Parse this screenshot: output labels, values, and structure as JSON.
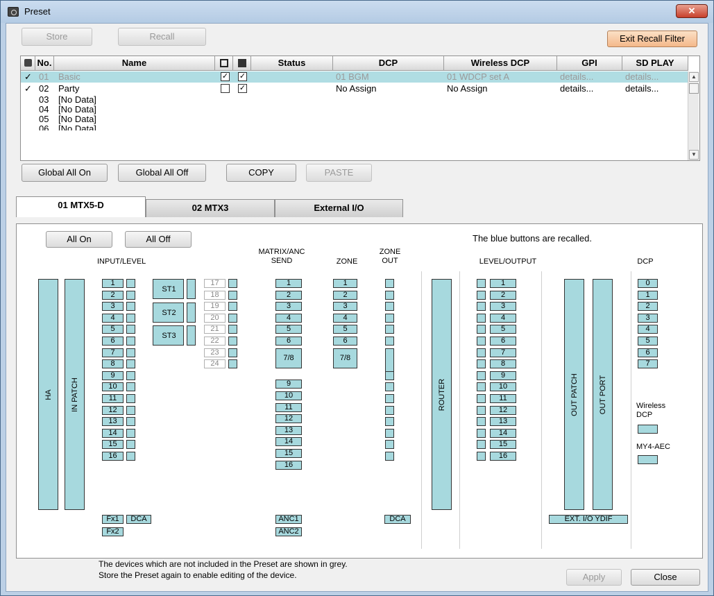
{
  "window": {
    "title": "Preset",
    "close": "✕"
  },
  "toolbar": {
    "store": "Store",
    "recall": "Recall",
    "exit_recall_filter": "Exit Recall Filter"
  },
  "table": {
    "columns": {
      "no": "No.",
      "name": "Name",
      "status": "Status",
      "dcp": "DCP",
      "wireless_dcp": "Wireless DCP",
      "gpi": "GPI",
      "sd_play": "SD PLAY"
    },
    "rows": [
      {
        "check": "✓",
        "no": "01",
        "name": "Basic",
        "lock": "✓",
        "recall": "✓",
        "dcp": "01 BGM",
        "wireless_dcp": "01 WDCP set A",
        "gpi": "details...",
        "sd_play": "details..."
      },
      {
        "check": "✓",
        "no": "02",
        "name": "Party",
        "lock": "",
        "recall": "✓",
        "dcp": "No Assign",
        "wireless_dcp": "No Assign",
        "gpi": "details...",
        "sd_play": "details..."
      },
      {
        "no": "03",
        "name": "[No Data]"
      },
      {
        "no": "04",
        "name": "[No Data]"
      },
      {
        "no": "05",
        "name": "[No Data]"
      },
      {
        "no": "06",
        "name": "[No Data]"
      }
    ]
  },
  "actions": {
    "global_all_on": "Global All On",
    "global_all_off": "Global All Off",
    "copy": "COPY",
    "paste": "PASTE"
  },
  "tabs": [
    "01 MTX5-D",
    "02 MTX3",
    "External I/O"
  ],
  "panel": {
    "all_on": "All On",
    "all_off": "All Off",
    "info": "The blue buttons are recalled.",
    "ha": "HA",
    "in_patch": "IN PATCH",
    "input_level": "INPUT/LEVEL",
    "matrix_send": "MATRIX/ANC\nSEND",
    "zone": "ZONE",
    "zone_out": "ZONE\nOUT",
    "router": "ROUTER",
    "level_output": "LEVEL/OUTPUT",
    "out_patch": "OUT PATCH",
    "out_port": "OUT PORT",
    "dcp": "DCP",
    "st": [
      "ST1",
      "ST2",
      "ST3"
    ],
    "inputs": [
      "1",
      "2",
      "3",
      "4",
      "5",
      "6",
      "7",
      "8",
      "9",
      "10",
      "11",
      "12",
      "13",
      "14",
      "15",
      "16"
    ],
    "inputs_b": [
      "17",
      "18",
      "19",
      "20",
      "21",
      "22",
      "23",
      "24"
    ],
    "zones": [
      "1",
      "2",
      "3",
      "4",
      "5",
      "6",
      "7/8"
    ],
    "matrix": [
      "1",
      "2",
      "3",
      "4",
      "5",
      "6",
      "7/8",
      "9",
      "10",
      "11",
      "12",
      "13",
      "14",
      "15",
      "16"
    ],
    "dcp_items": [
      "0",
      "1",
      "2",
      "3",
      "4",
      "5",
      "6",
      "7"
    ],
    "fx1": "Fx1",
    "fx2": "Fx2",
    "dca": "DCA",
    "anc1": "ANC1",
    "anc2": "ANC2",
    "zone_dca": "DCA",
    "ext_io": "EXT. I/O YDIF",
    "wireless_dcp": "Wireless\nDCP",
    "my4aec": "MY4-AEC"
  },
  "footer": {
    "note1": "The devices which are not included in the Preset are shown in grey.",
    "note2": "Store the Preset again to enable editing of the device.",
    "apply": "Apply",
    "close": "Close"
  }
}
